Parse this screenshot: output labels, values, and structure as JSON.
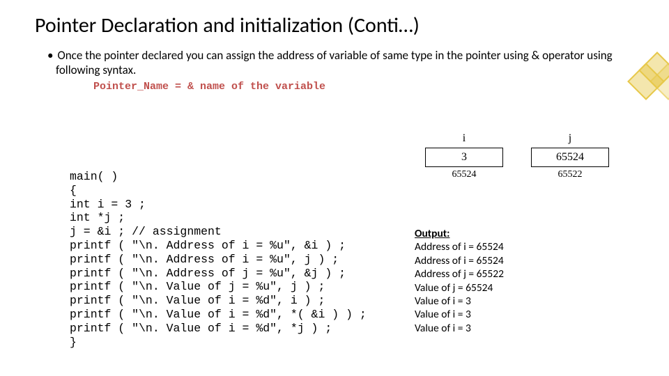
{
  "title": "Pointer Declaration and initialization (Conti…)",
  "bullet": "Once the pointer declared you can assign the address of variable of same type in the pointer using & operator using following syntax.",
  "syntax": "Pointer_Name = & name of the variable",
  "code": "main( )\n{\nint i = 3 ;\nint *j ;\nj = &i ; // assignment\nprintf ( \"\\n. Address of i = %u\", &i ) ;\nprintf ( \"\\n. Address of i = %u\", j ) ;\nprintf ( \"\\n. Address of j = %u\", &j ) ;\nprintf ( \"\\n. Value of j = %u\", j ) ;\nprintf ( \"\\n. Value of i = %d\", i ) ;\nprintf ( \"\\n. Value of i = %d\", *( &i ) ) ;\nprintf ( \"\\n. Value of i = %d\", *j ) ;\n}",
  "mem": {
    "i": {
      "var": "i",
      "val": "3",
      "addr": "65524"
    },
    "j": {
      "var": "j",
      "val": "65524",
      "addr": "65522"
    }
  },
  "output": {
    "header": "Output:",
    "lines": [
      "Address of i = 65524",
      "Address of i = 65524",
      "Address of j = 65522",
      "Value of j = 65524",
      "Value of i = 3",
      "Value of i = 3",
      "Value of i = 3"
    ]
  }
}
